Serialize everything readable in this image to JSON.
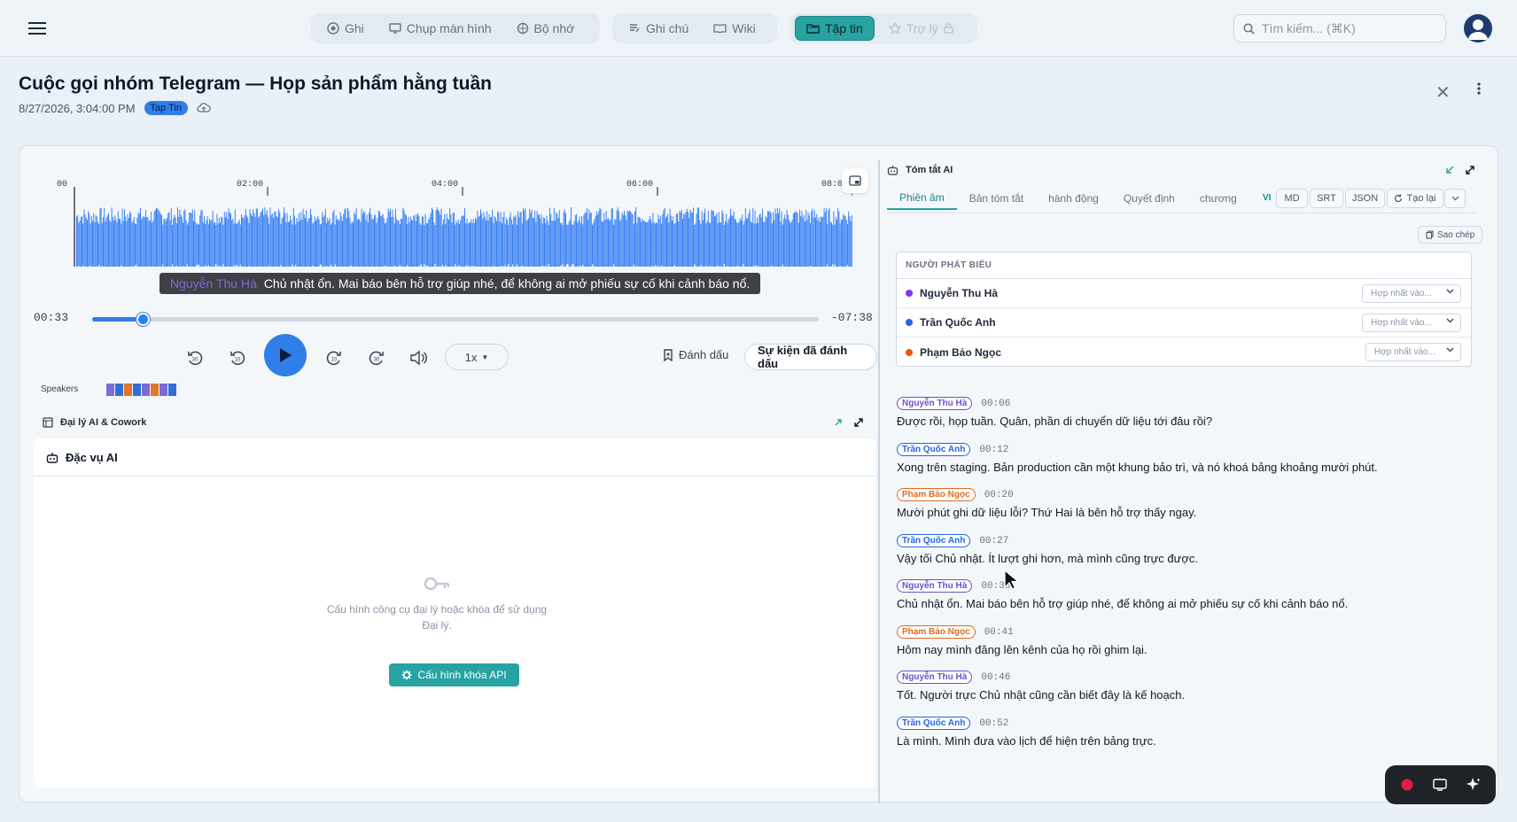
{
  "nav": {
    "menu_icon": "hamburger-icon",
    "groups": [
      [
        {
          "label": "Ghi",
          "icon": "record-icon"
        },
        {
          "label": "Chụp màn hình",
          "icon": "monitor-icon"
        },
        {
          "label": "Bộ nhớ",
          "icon": "brain-icon"
        }
      ],
      [
        {
          "label": "Ghi chú",
          "icon": "note-icon"
        },
        {
          "label": "Wiki",
          "icon": "book-icon"
        }
      ],
      [
        {
          "label": "Tập tin",
          "icon": "folder-icon",
          "active": true
        },
        {
          "label": "Trợ lý",
          "icon": "assistant-icon",
          "disabled": true
        }
      ]
    ],
    "search_placeholder": "Tìm kiếm... (⌘K)"
  },
  "header": {
    "title": "Cuộc gọi nhóm Telegram — Họp sản phẩm hằng tuần",
    "datetime": "8/27/2026, 3:04:00 PM",
    "badge": "Tap Tin"
  },
  "player": {
    "timeline_labels": [
      "00",
      "02:00",
      "04:00",
      "06:00",
      "08:0"
    ],
    "caption_speaker": "Nguyễn Thu Hà",
    "caption_text": "Chủ nhật ổn. Mai báo bên hỗ trợ giúp nhé, để không ai mở phiếu sự cố khi cảnh báo nổ.",
    "current_time": "00:33",
    "remaining_time": "-07:38",
    "progress": 0.07,
    "speed": "1x",
    "mark_label": "Đánh dấu",
    "marked_events_label": "Sự kiện đã đánh dấu",
    "speakers_label": "Speakers",
    "speaker_strip_colors": [
      "#7c6bd6",
      "#2f6fd6",
      "#e0762b",
      "#2f6fd6",
      "#7c6bd6",
      "#e0762b",
      "#7c6bd6",
      "#2f6fd6"
    ]
  },
  "agent": {
    "section_title": "Đại lý AI & Cowork",
    "tab_label": "Đặc vụ AI",
    "empty_text": "Cấu hình công cụ đại lý hoặc khóa để sử dụng Đại lý.",
    "api_button": "Cấu hình khóa API"
  },
  "summary": {
    "title": "Tóm tắt AI",
    "tabs": [
      "Phiên âm",
      "Bản tóm tắt",
      "hành động",
      "Quyết định",
      "chương"
    ],
    "lang": "VI",
    "formats": [
      "MD",
      "SRT",
      "JSON"
    ],
    "regen_label": "Tạo lại",
    "copy_label": "Sao chép",
    "speakers_header": "NGƯỜI PHÁT BIỂU",
    "merge_placeholder": "Hợp nhất vào...",
    "speakers": [
      {
        "name": "Nguyễn Thu Hà",
        "color": "#7c3aed"
      },
      {
        "name": "Trần Quốc Anh",
        "color": "#2563eb"
      },
      {
        "name": "Phạm Bảo Ngọc",
        "color": "#ea580c"
      }
    ],
    "transcript": [
      {
        "speaker": "Nguyễn Thu Hà",
        "color": "#6d4fd0",
        "time": "00:06",
        "text": "Được rồi, họp tuần. Quân, phần di chuyển dữ liệu tới đâu rồi?"
      },
      {
        "speaker": "Trần Quốc Anh",
        "color": "#2563eb",
        "time": "00:12",
        "text": "Xong trên staging. Bản production cần một khung bảo trì, và nó khoá bảng khoảng mười phút."
      },
      {
        "speaker": "Phạm Bảo Ngọc",
        "color": "#dd6b20",
        "time": "00:20",
        "text": "Mười phút ghi dữ liệu lỗi? Thứ Hai là bên hỗ trợ thấy ngay."
      },
      {
        "speaker": "Trần Quốc Anh",
        "color": "#2563eb",
        "time": "00:27",
        "text": "Vậy tối Chủ nhật. Ít lượt ghi hơn, mà mình cũng trực được."
      },
      {
        "speaker": "Nguyễn Thu Hà",
        "color": "#6d4fd0",
        "time": "00:33",
        "text": "Chủ nhật ổn. Mai báo bên hỗ trợ giúp nhé, để không ai mở phiếu sự cố khi cảnh báo nổ."
      },
      {
        "speaker": "Phạm Bảo Ngọc",
        "color": "#dd6b20",
        "time": "00:41",
        "text": "Hôm nay mình đăng lên kênh của họ rồi ghim lại."
      },
      {
        "speaker": "Nguyễn Thu Hà",
        "color": "#6d4fd0",
        "time": "00:46",
        "text": "Tốt. Người trực Chủ nhật cũng cần biết đây là kế hoạch."
      },
      {
        "speaker": "Trần Quốc Anh",
        "color": "#2563eb",
        "time": "00:52",
        "text": "Là mình. Mình đưa vào lịch để hiện trên bảng trực."
      }
    ]
  }
}
